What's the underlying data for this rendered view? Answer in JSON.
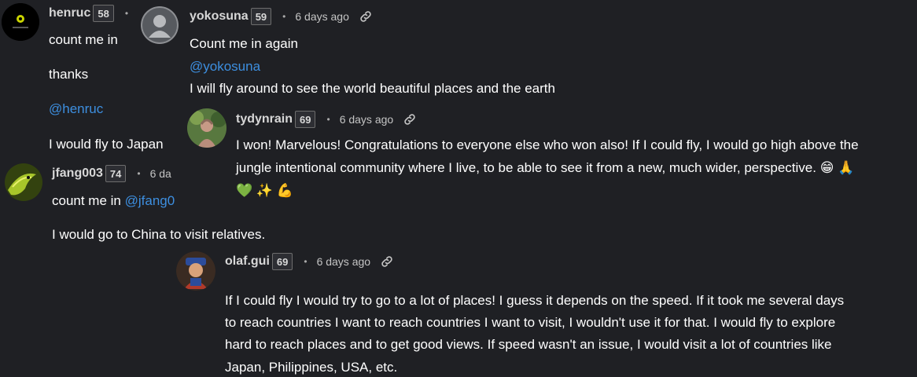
{
  "comments": [
    {
      "username": "henruc",
      "level": "58",
      "lines": [
        "count me in",
        "thanks",
        "@henruc",
        "I would fly to Japan"
      ]
    },
    {
      "username": "yokosuna",
      "level": "59",
      "time": "6 days ago",
      "lines": [
        "Count me in again",
        "@yokosuna",
        "I will fly around to see the world beautiful places and the earth"
      ]
    },
    {
      "username": "tydynrain",
      "level": "69",
      "time": "6 days ago",
      "lines": [
        "I won! Marvelous! Congratulations to everyone else who won also! If I could fly, I would go high above the",
        "jungle intentional community where I live, to be able to see it from a new, much wider, perspective. 😁 🙏",
        "💚 ✨ 💪"
      ]
    },
    {
      "username": "jfang003",
      "level": "74",
      "time": "6 da",
      "lines": [
        "count me in ",
        "@jfang0",
        "I would go to China to visit relatives."
      ]
    },
    {
      "username": "olaf.gui",
      "level": "69",
      "time": "6 days ago",
      "lines": [
        "If I could fly I would try to go to a lot of places! I guess it depends on the speed. If it took me several days",
        "to reach countries I want to reach countries I want to visit, I wouldn't use it for that. I would fly to explore",
        "hard to reach places and to get good views. If speed wasn't an issue, I would visit a lot of countries like",
        "Japan, Philippines, USA, etc."
      ]
    }
  ],
  "colors": {
    "background": "#1f2024",
    "mention": "#3d8fe0",
    "username": "#d7d7d7"
  },
  "icons": [
    "default-avatar-icon",
    "link-icon"
  ]
}
